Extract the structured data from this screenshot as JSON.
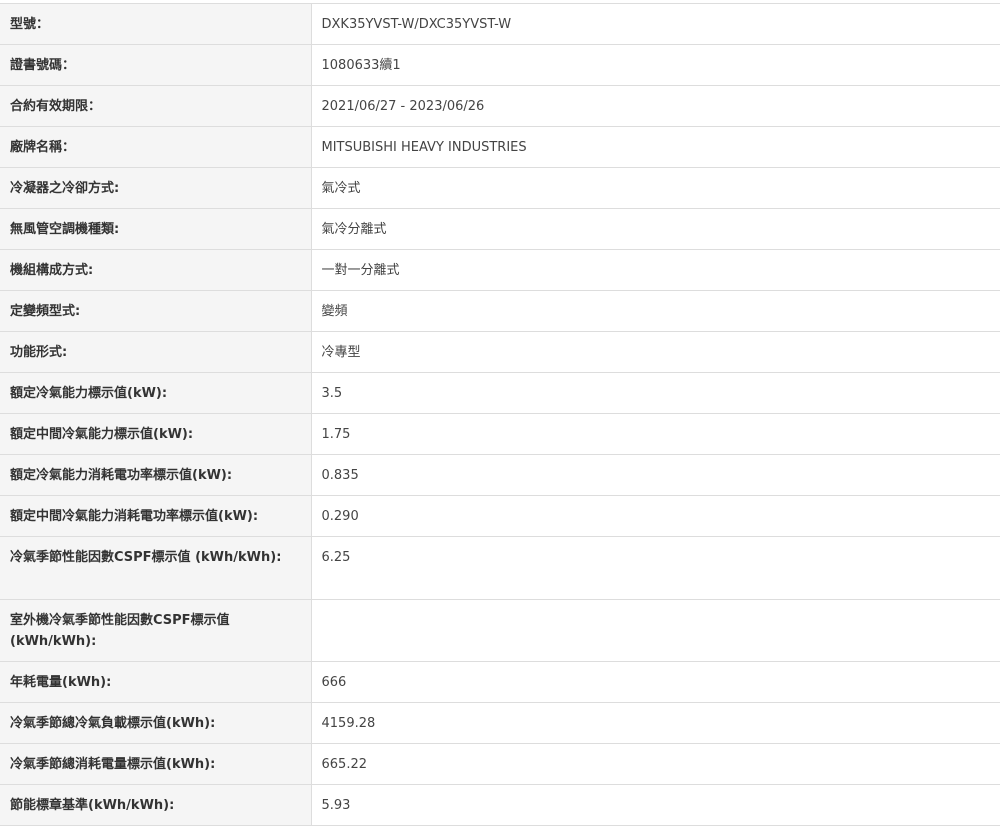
{
  "rows": [
    {
      "label": "型號：",
      "value": "DXK35YVST-W/DXC35YVST-W"
    },
    {
      "label": "證書號碼：",
      "value": "1080633續1"
    },
    {
      "label": "合約有效期限：",
      "value": "2021/06/27 - 2023/06/26"
    },
    {
      "label": "廠牌名稱：",
      "value": "MITSUBISHI HEAVY INDUSTRIES"
    },
    {
      "label": "冷凝器之冷卻方式:",
      "value": "氣冷式"
    },
    {
      "label": "無風管空調機種類:",
      "value": "氣冷分離式"
    },
    {
      "label": "機組構成方式:",
      "value": "一對一分離式"
    },
    {
      "label": "定變頻型式:",
      "value": "變頻"
    },
    {
      "label": "功能形式:",
      "value": "冷專型"
    },
    {
      "label": "額定冷氣能力標示值(kW):",
      "value": "3.5"
    },
    {
      "label": "額定中間冷氣能力標示值(kW):",
      "value": "1.75"
    },
    {
      "label": "額定冷氣能力消耗電功率標示值(kW):",
      "value": "0.835"
    },
    {
      "label": "額定中間冷氣能力消耗電功率標示值(kW):",
      "value": "0.290"
    },
    {
      "label": "冷氣季節性能因數CSPF標示值 (kWh/kWh):",
      "value": "6.25"
    },
    {
      "label": "室外機冷氣季節性能因數CSPF標示值 (kWh/kWh):",
      "value": ""
    },
    {
      "label": "年耗電量(kWh):",
      "value": "666"
    },
    {
      "label": "冷氣季節總冷氣負載標示值(kWh):",
      "value": "4159.28"
    },
    {
      "label": "冷氣季節總消耗電量標示值(kWh):",
      "value": "665.22"
    },
    {
      "label": "節能標章基準(kWh/kWh):",
      "value": "5.93"
    }
  ]
}
